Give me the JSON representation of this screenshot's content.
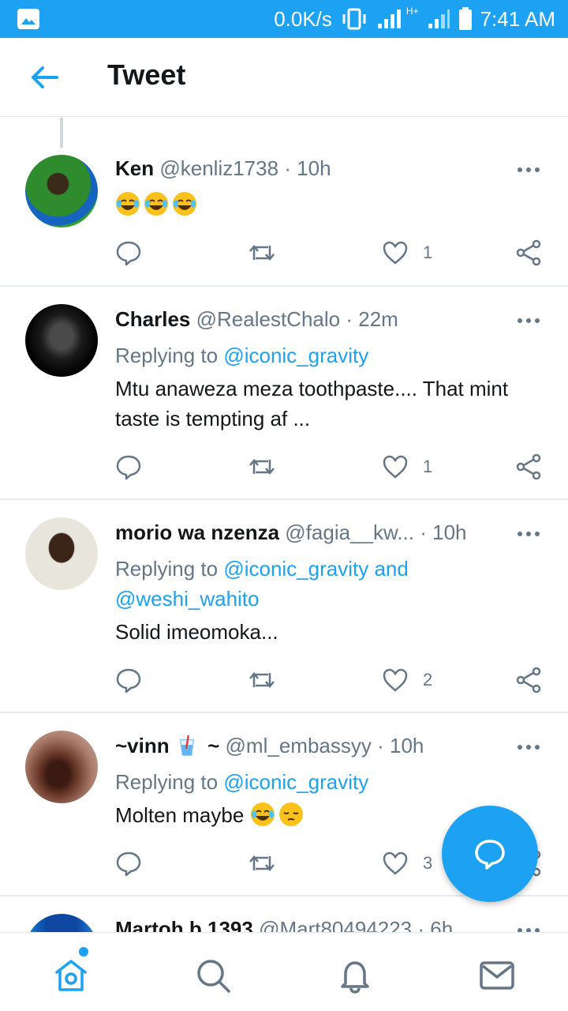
{
  "status_bar": {
    "speed": "0.0K/s",
    "network": "H+",
    "time": "7:41 AM"
  },
  "header": {
    "title": "Tweet",
    "back_icon": "arrow-left-icon"
  },
  "colors": {
    "accent": "#1da1f2",
    "secondary_text": "#657786",
    "primary_text": "#14171a",
    "divider": "#e6ecf0"
  },
  "tweets": [
    {
      "name": "Ken",
      "handle": "@kenliz1738",
      "dot": "·",
      "time": "10h",
      "text_emojis": [
        "face-with-tears-of-joy",
        "face-with-tears-of-joy",
        "face-with-tears-of-joy"
      ],
      "like_count": "1"
    },
    {
      "name": "Charles",
      "handle": "@RealestChalo",
      "dot": "·",
      "time": "22m",
      "replying_prefix": "Replying to",
      "replying_mention": "@iconic_gravity",
      "text": "Mtu anaweza meza toothpaste.... That mint taste is tempting af ...",
      "like_count": "1"
    },
    {
      "name": "morio wa nzenza",
      "handle": "@fagia__kw...",
      "dot": "·",
      "time": "10h",
      "replying_prefix": "Replying to",
      "replying_mention": "@iconic_gravity and",
      "replying_mention2": "@weshi_wahito",
      "text": "Solid imeomoka...",
      "like_count": "2"
    },
    {
      "name": "~vinn",
      "name_suffix": "~",
      "name_emoji": "tropical-drink",
      "handle": "@ml_embassyy",
      "dot": "·",
      "time": "10h",
      "replying_prefix": "Replying to",
      "replying_mention": "@iconic_gravity",
      "text": "Molten maybe",
      "text_emojis": [
        "face-with-tears-of-joy",
        "pensive-face"
      ],
      "like_count": "3"
    },
    {
      "name": "Martoh b 1393",
      "handle": "@Mart80494223",
      "dot": "·",
      "time": "6h"
    }
  ],
  "bottom_nav": {
    "items": [
      "home-icon",
      "search-icon",
      "notifications-icon",
      "messages-icon"
    ]
  }
}
